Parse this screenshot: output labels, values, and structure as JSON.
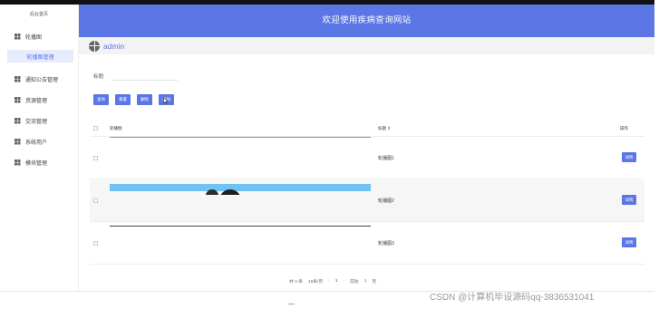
{
  "sidebar": {
    "title": "后台首页",
    "items": [
      {
        "label": "轮播图"
      },
      {
        "label": "通知公告管理"
      },
      {
        "label": "资源管理"
      },
      {
        "label": "交流管理"
      },
      {
        "label": "系统用户"
      },
      {
        "label": "模块管理"
      }
    ],
    "active_sub": "轮播图管理"
  },
  "header": {
    "title": "欢迎使用疾病查询网站"
  },
  "user": {
    "name": "admin"
  },
  "search": {
    "label": "标题:",
    "value": ""
  },
  "toolbar": {
    "query": "查询",
    "reset": "重置",
    "delete": "删除",
    "add": "添加"
  },
  "table": {
    "columns": {
      "image": "轮播图",
      "title": "标题 ⇕",
      "action": "操作"
    },
    "rows": [
      {
        "title": "轮播图1",
        "action": "详情"
      },
      {
        "title": "轮播图2",
        "action": "详情"
      },
      {
        "title": "轮播图3",
        "action": "详情"
      }
    ]
  },
  "pagination": {
    "total": "共 3 条",
    "page_size": "10条/页",
    "prev": "‹",
    "current": "1",
    "next": "›",
    "goto_label": "前往",
    "goto_value": "1",
    "page_unit": "页"
  },
  "caption": "—",
  "watermark": "CSDN @计算机毕设源码qq-3836531041",
  "colors": {
    "accent": "#5b76e5"
  }
}
